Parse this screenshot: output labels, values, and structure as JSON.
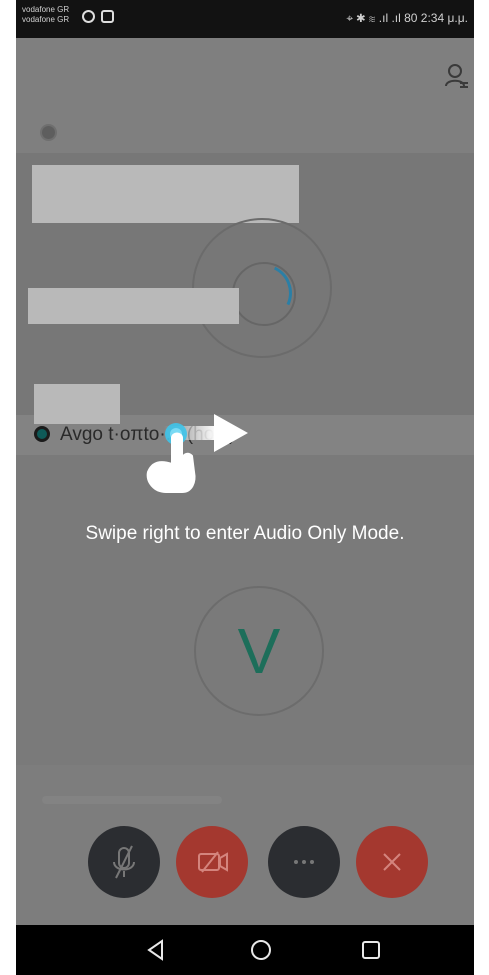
{
  "status_bar": {
    "carrier_line1": "vodafone GR",
    "carrier_line2": "vodafone GR",
    "right_text": "⌖ ✱ ≋ .ıl .ıl 80 2:34 μ.μ."
  },
  "participant": {
    "name": "Avgo t·oπto·... (host)"
  },
  "avatar": {
    "letter": "V",
    "color": "#1d6e5a"
  },
  "overlay": {
    "swipe_hint": "Swipe right to enter Audio Only Mode."
  },
  "controls": {
    "mic_icon": "mic-muted-icon",
    "video_icon": "video-off-icon",
    "more_icon": "more-icon",
    "end_icon": "end-call-icon",
    "accent_red": "#a4382f",
    "dark": "#2b2d31"
  },
  "navigation": {
    "back_icon": "back-icon",
    "home_icon": "home-icon",
    "recents_icon": "recents-icon"
  }
}
